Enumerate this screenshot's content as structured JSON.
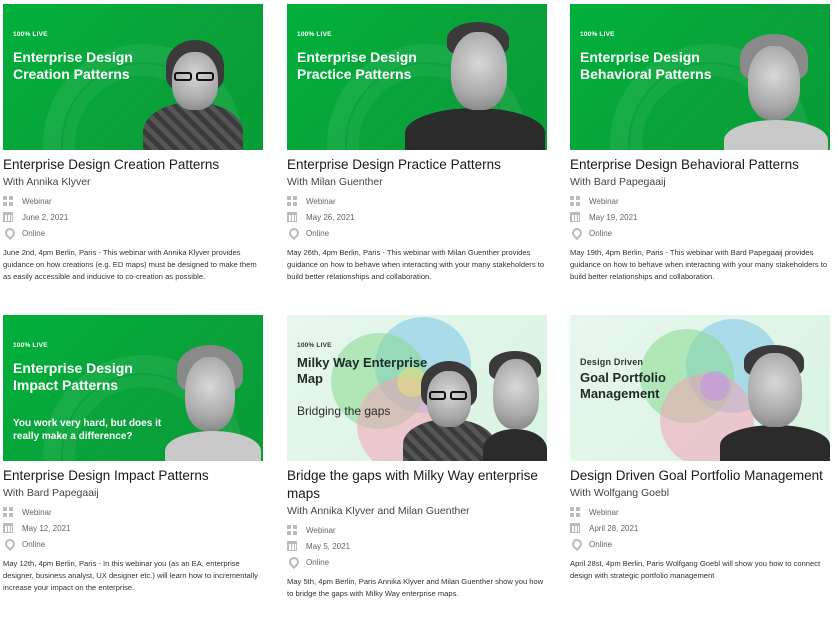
{
  "cards": [
    {
      "badge": "100% LIVE",
      "thumb_title": "Enterprise Design Creation Patterns",
      "title": "Enterprise Design Creation Patterns",
      "with": "With Annika Klyver",
      "type": "Webinar",
      "date": "June 2, 2021",
      "location": "Online",
      "description": "June 2nd, 4pm Berlin, Paris - This webinar with Annika Klyver provides guidance on how creations (e.g. ED maps) must be designed to make them as easily accessible and inducive to co-creation as possible."
    },
    {
      "badge": "100% LIVE",
      "thumb_title": "Enterprise Design Practice Patterns",
      "title": "Enterprise Design Practice Patterns",
      "with": "With Milan Guenther",
      "type": "Webinar",
      "date": "May 26, 2021",
      "location": "Online",
      "description": "May 26th, 4pm Berlin, Paris - This webinar with Milan Guenther provides guidance on how to behave when interacting with your many stakeholders to build better relationships and collaboration."
    },
    {
      "badge": "100% LIVE",
      "thumb_title": "Enterprise Design Behavioral Patterns",
      "title": "Enterprise Design Behavioral Patterns",
      "with": "With Bard Papegaaij",
      "type": "Webinar",
      "date": "May 19, 2021",
      "location": "Online",
      "description": "May 19th, 4pm Berlin, Paris - This webinar with Bard Papegaaij provides guidance on how to behave when interacting with your many stakeholders to build better relationships and collaboration."
    },
    {
      "badge": "100% LIVE",
      "thumb_title": "Enterprise Design Impact Patterns",
      "thumb_subtitle": "You work very hard, but does it really make a difference?",
      "title": "Enterprise Design Impact Patterns",
      "with": "With Bard Papegaaij",
      "type": "Webinar",
      "date": "May 12, 2021",
      "location": "Online",
      "description": "May 12th, 4pm Berlin, Paris - In this webinar you (as an EA, enterprise designer, business analyst, UX designer etc.) will learn how to incrementally increase your impact on the enterprise."
    },
    {
      "badge": "100% LIVE",
      "thumb_title": "Milky Way Enterprise Map",
      "thumb_subtitle": "Bridging the gaps",
      "title": "Bridge the gaps with Milky Way enterprise maps",
      "with": "With Annika Klyver and Milan Guenther",
      "type": "Webinar",
      "date": "May 5, 2021",
      "location": "Online",
      "description": "May 5th, 4pm Berlin, Paris Annika Klyver and Milan Guenther show you how to bridge the gaps with Milky Way enterprise maps."
    },
    {
      "badge": "Design Driven",
      "thumb_title": "Goal Portfolio Management",
      "title": "Design Driven Goal Portfolio Management",
      "with": "With Wolfgang Goebl",
      "type": "Webinar",
      "date": "April 28, 2021",
      "location": "Online",
      "description": "April 28st, 4pm Berlin, Paris Wolfgang Goebl will show you how to connect design with strategic portfolio management"
    }
  ]
}
